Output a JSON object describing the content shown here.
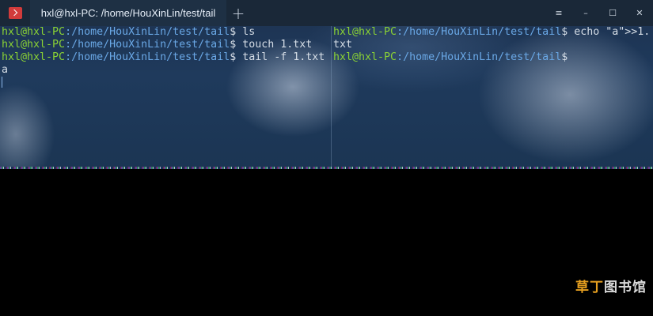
{
  "window": {
    "tab_title": "hxl@hxl-PC: /home/HouXinLin/test/tail",
    "new_tab_glyph": "+",
    "controls": {
      "menu": "≡",
      "minimize": "–",
      "maximize": "☐",
      "close": "✕"
    },
    "app_icon_color": "#d23b3b"
  },
  "left_pane": {
    "lines": [
      {
        "user": "hxl@hxl-PC",
        "path": ":/home/HouXinLin/test/tail",
        "prompt": "$ ",
        "command": "ls"
      },
      {
        "user": "hxl@hxl-PC",
        "path": ":/home/HouXinLin/test/tail",
        "prompt": "$ ",
        "command": "touch 1.txt"
      },
      {
        "user": "hxl@hxl-PC",
        "path": ":/home/HouXinLin/test/tail",
        "prompt": "$ ",
        "command": "tail -f 1.txt"
      }
    ],
    "output": "a"
  },
  "right_pane": {
    "line1": {
      "user": "hxl@hxl-PC",
      "path": ":/home/HouXinLin/test/tail",
      "prompt": "$ ",
      "command": "echo \"a\">>1."
    },
    "line2": "txt",
    "line3": {
      "user": "hxl@hxl-PC",
      "path": ":/home/HouXinLin/test/tail",
      "prompt": "$"
    }
  },
  "watermark": {
    "part1": "草丁",
    "part2": "图书馆"
  },
  "colors": {
    "user": "#8ad234",
    "path": "#6aa8e6",
    "titlebar": "#1a2838",
    "watermark_accent": "#e7a020"
  }
}
